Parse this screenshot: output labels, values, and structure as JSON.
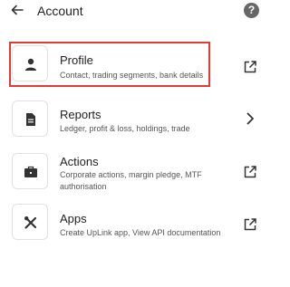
{
  "header": {
    "back_icon": "back-arrow-icon",
    "title": "Account",
    "help_label": "?",
    "help_icon": "help-circle-icon"
  },
  "items": [
    {
      "id": "profile",
      "title": "Profile",
      "description": "Contact, trading segments, bank details",
      "icon": "person-icon",
      "trailing_icon": "external-link-icon",
      "highlighted": true
    },
    {
      "id": "reports",
      "title": "Reports",
      "description": "Ledger, profit & loss, holdings, trade",
      "icon": "document-icon",
      "trailing_icon": "chevron-right-icon",
      "highlighted": false
    },
    {
      "id": "actions",
      "title": "Actions",
      "description": "Corporate actions, margin pledge, MTF authorisation",
      "icon": "briefcase-icon",
      "trailing_icon": "external-link-icon",
      "highlighted": false
    },
    {
      "id": "apps",
      "title": "Apps",
      "description": "Create UpLink app, View API documentation",
      "icon": "tools-icon",
      "trailing_icon": "external-link-icon",
      "highlighted": false
    }
  ],
  "colors": {
    "highlight": "#e53935",
    "icon": "#333333",
    "text_primary": "#222222",
    "text_secondary": "#555555"
  }
}
